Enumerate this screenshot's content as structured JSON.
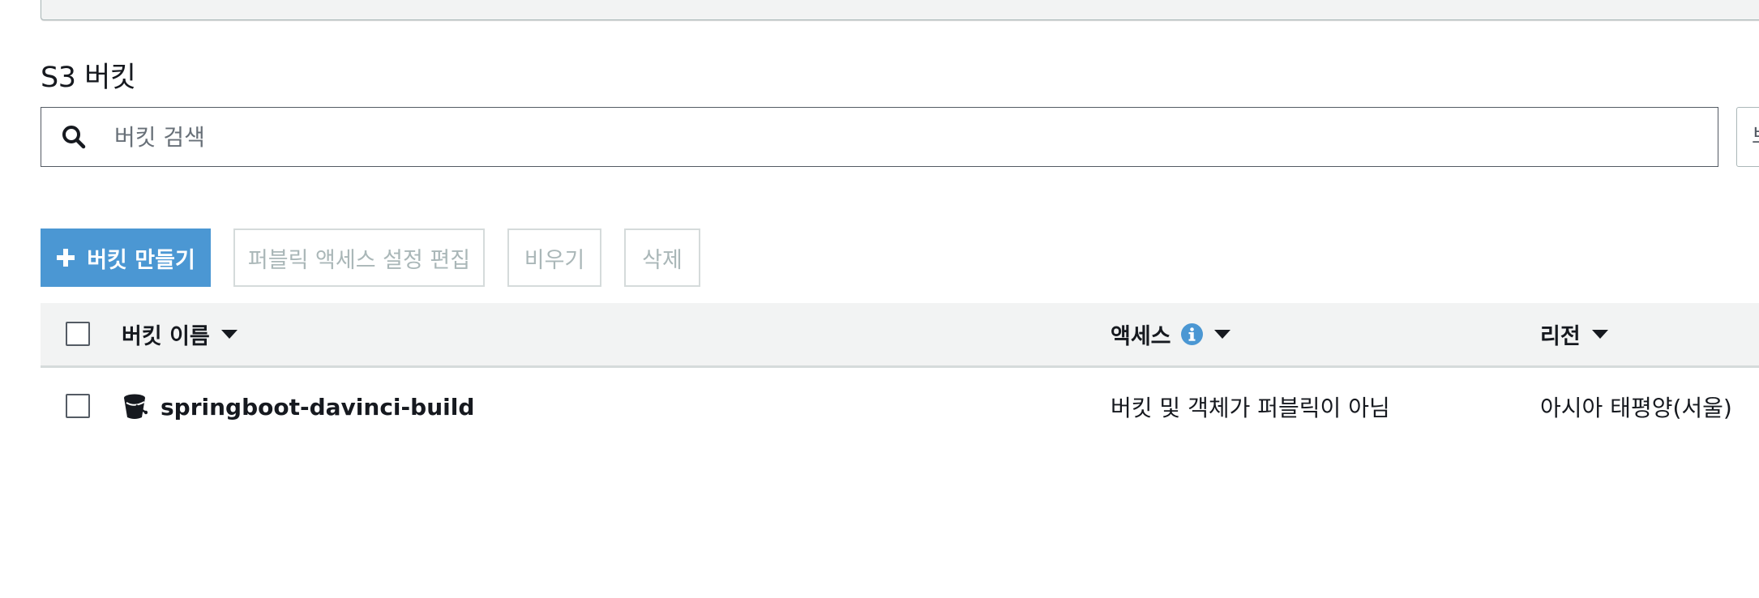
{
  "section": {
    "title": "S3 버킷"
  },
  "search": {
    "placeholder": "버킷 검색",
    "value": "",
    "extra_glyph": "보"
  },
  "toolbar": {
    "create_label": "버킷 만들기",
    "edit_public_access_label": "퍼블릭 액세스 설정 편집",
    "empty_label": "비우기",
    "delete_label": "삭제"
  },
  "table": {
    "columns": [
      {
        "label": "버킷 이름"
      },
      {
        "label": "액세스"
      },
      {
        "label": "리전"
      }
    ],
    "rows": [
      {
        "name": "springboot-davinci-build",
        "access": "버킷 및 객체가 퍼블릭이 아님",
        "region": "아시아 태평양(서울)"
      }
    ]
  },
  "colors": {
    "primary": "#4b97d3",
    "header_bg": "#f2f3f3",
    "disabled_text": "#aab7b8",
    "border": "#d5dbdb"
  },
  "icons": [
    "search-icon",
    "plus-icon",
    "info-icon",
    "caret-down-icon",
    "bucket-icon"
  ]
}
